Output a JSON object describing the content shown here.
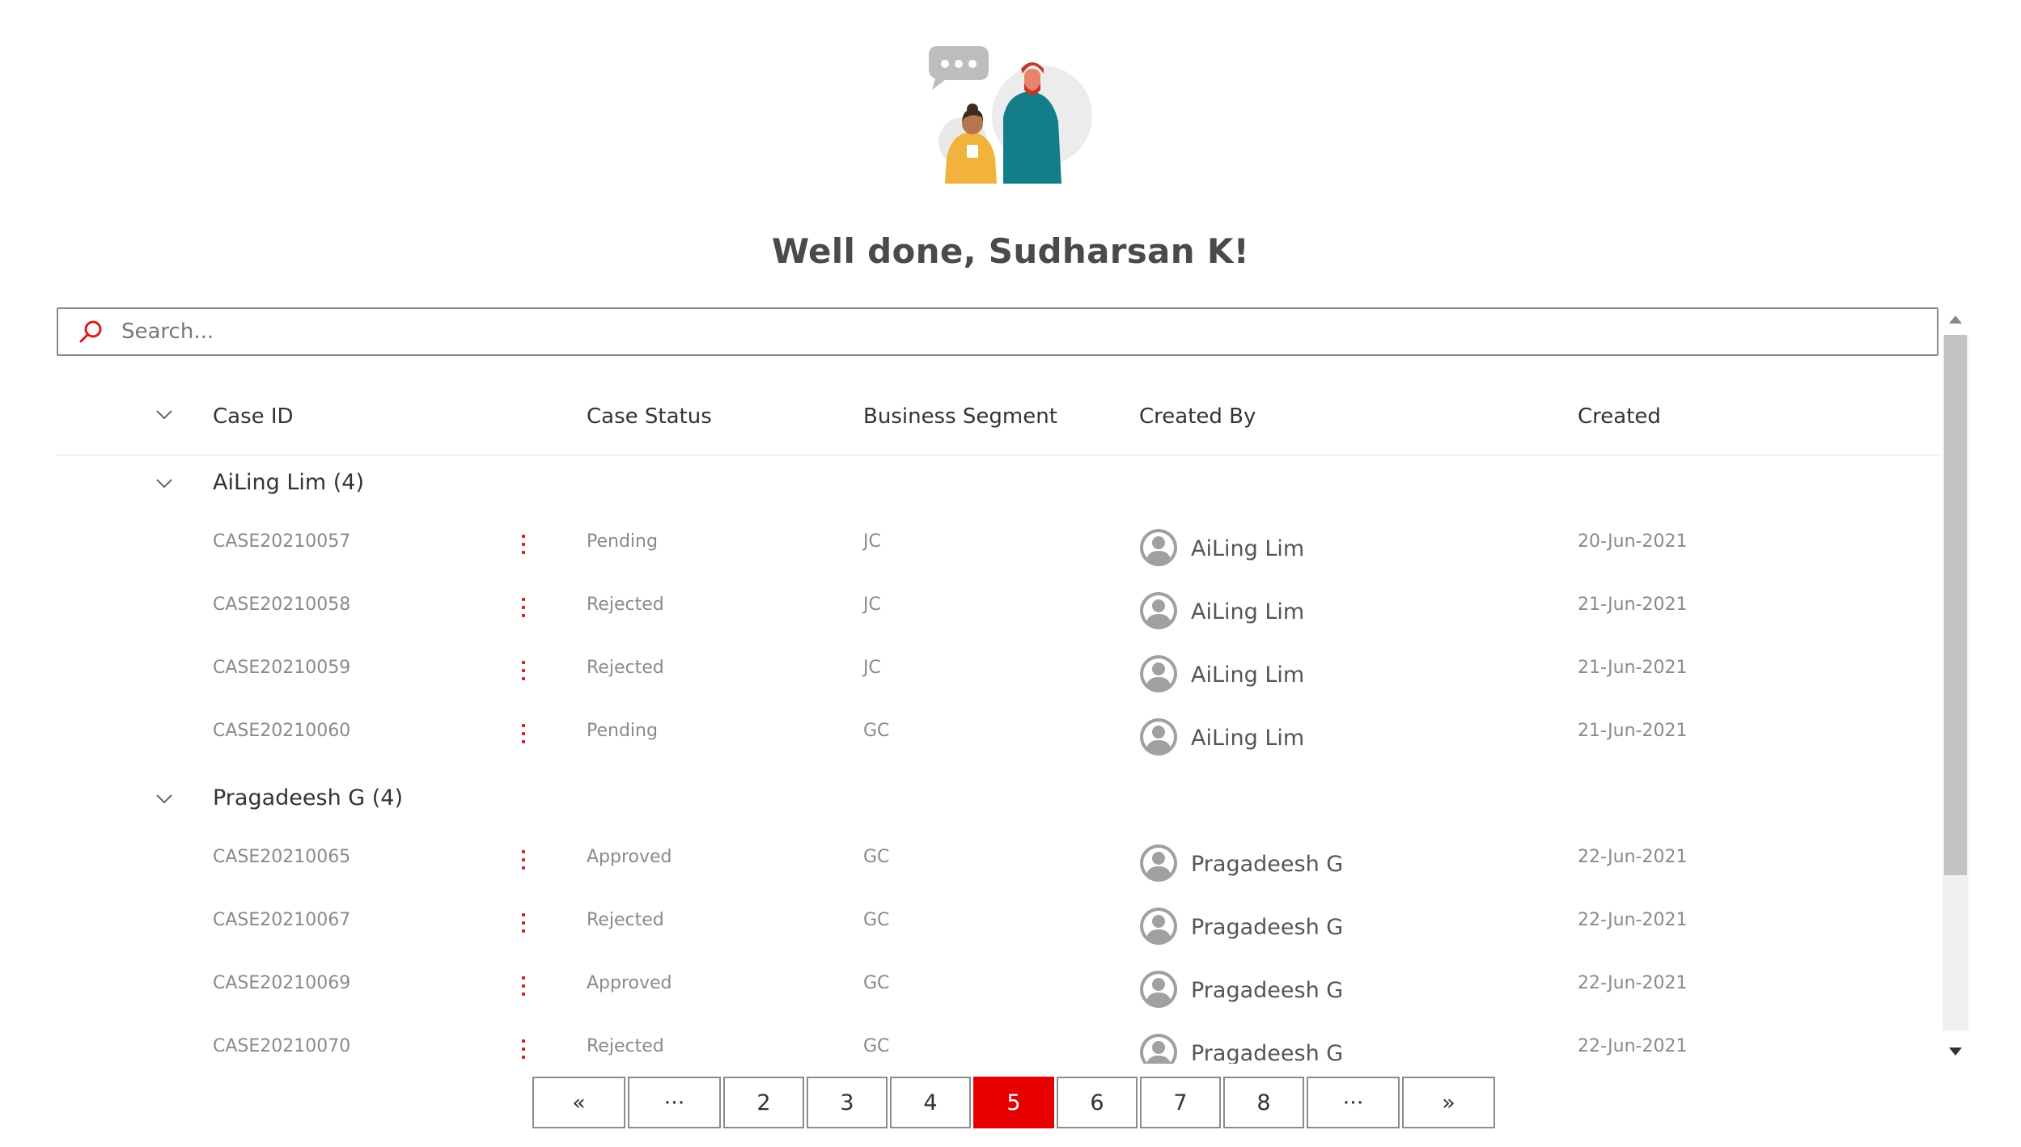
{
  "header": {
    "title": "Well done, Sudharsan K!"
  },
  "search": {
    "placeholder": "Search..."
  },
  "table": {
    "columns": {
      "case_id": "Case ID",
      "case_status": "Case Status",
      "business_segment": "Business Segment",
      "created_by": "Created By",
      "created": "Created"
    },
    "groups": [
      {
        "label": "AiLing Lim (4)",
        "rows": [
          {
            "case_id": "CASE20210057",
            "status": "Pending",
            "segment": "JC",
            "created_by": "AiLing Lim",
            "created": "20-Jun-2021"
          },
          {
            "case_id": "CASE20210058",
            "status": "Rejected",
            "segment": "JC",
            "created_by": "AiLing Lim",
            "created": "21-Jun-2021"
          },
          {
            "case_id": "CASE20210059",
            "status": "Rejected",
            "segment": "JC",
            "created_by": "AiLing Lim",
            "created": "21-Jun-2021"
          },
          {
            "case_id": "CASE20210060",
            "status": "Pending",
            "segment": "GC",
            "created_by": "AiLing Lim",
            "created": "21-Jun-2021"
          }
        ]
      },
      {
        "label": "Pragadeesh G (4)",
        "rows": [
          {
            "case_id": "CASE20210065",
            "status": "Approved",
            "segment": "GC",
            "created_by": "Pragadeesh G",
            "created": "22-Jun-2021"
          },
          {
            "case_id": "CASE20210067",
            "status": "Rejected",
            "segment": "GC",
            "created_by": "Pragadeesh G",
            "created": "22-Jun-2021"
          },
          {
            "case_id": "CASE20210069",
            "status": "Approved",
            "segment": "GC",
            "created_by": "Pragadeesh G",
            "created": "22-Jun-2021"
          },
          {
            "case_id": "CASE20210070",
            "status": "Rejected",
            "segment": "GC",
            "created_by": "Pragadeesh G",
            "created": "22-Jun-2021"
          }
        ]
      }
    ]
  },
  "pagination": {
    "first": "«",
    "ellipsis_left": "···",
    "pages": [
      "2",
      "3",
      "4",
      "5",
      "6",
      "7",
      "8"
    ],
    "current": "5",
    "ellipsis_right": "···",
    "last": "»"
  },
  "colors": {
    "accent": "#e60000",
    "row_text": "#8a8a8a",
    "header_text": "#333333"
  },
  "icons": {
    "search": "search-icon",
    "expand": "chevron-down-icon",
    "more": "more-vertical-icon",
    "avatar": "user-avatar-icon"
  }
}
